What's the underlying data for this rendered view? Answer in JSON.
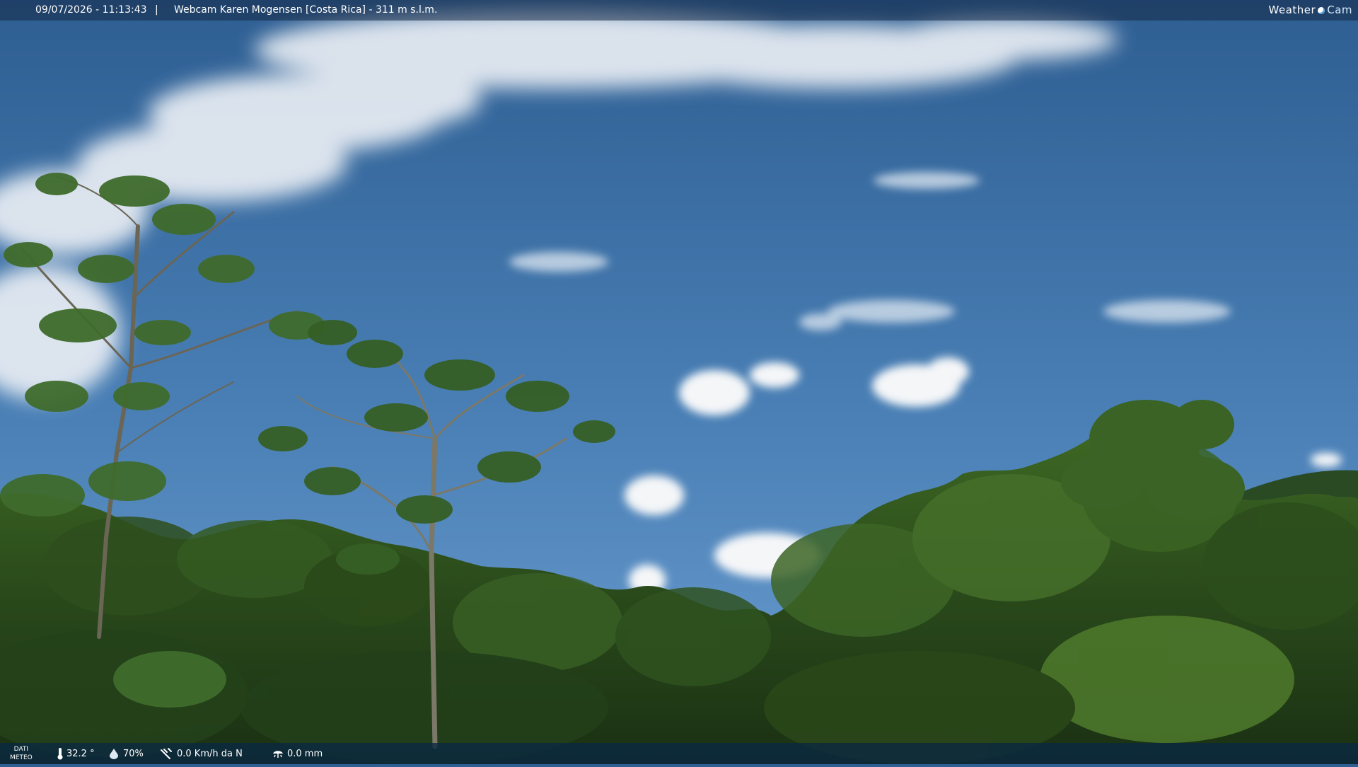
{
  "overlay": {
    "datetime": "09/07/2026 - 11:13:43",
    "separator": "|",
    "caption": "Webcam Karen Mogensen [Costa Rica] - 311 m s.l.m.",
    "logo_left": "Weather",
    "logo_right": "Cam"
  },
  "weather": {
    "label_line1": "DATI",
    "label_line2": "METEO",
    "temperature": "32.2 °",
    "humidity": "70%",
    "wind": "0.0 Km/h da N",
    "rain": "0.0 mm"
  },
  "icons": {
    "temperature": "thermometer-icon",
    "humidity": "humidity-drop-icon",
    "wind": "wind-icon",
    "rain": "rain-gauge-icon",
    "logo": "weathercam-logo-icon"
  },
  "colors": {
    "sky_top": "#2f5f93",
    "sky_bottom": "#5f93c6",
    "foliage_dark": "#1c3416",
    "foliage_light": "#4f7a2c",
    "cloud": "#f4f6f8",
    "bar": "#0a2841"
  }
}
